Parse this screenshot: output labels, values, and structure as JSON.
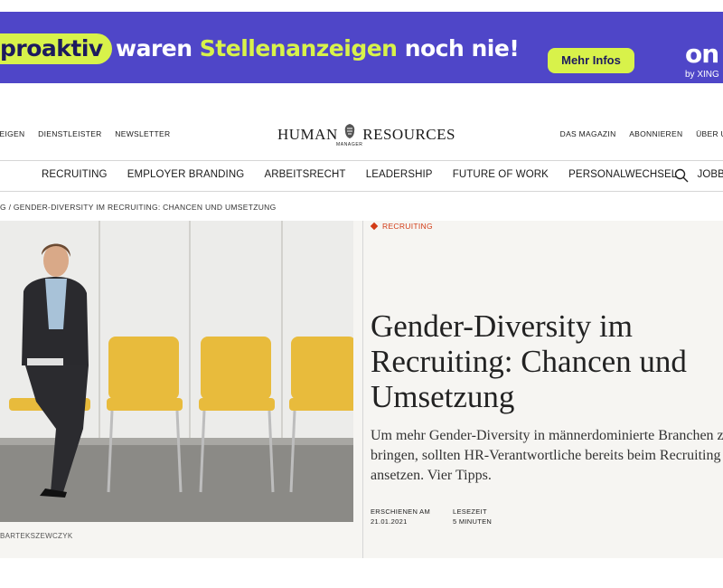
{
  "ad": {
    "pill_text": "proaktiv",
    "text_main": "waren",
    "text_highlight": "Stellenanzeigen",
    "text_end": "noch nie!",
    "button_label": "Mehr Infos",
    "logo": "on",
    "logo_sub": "by XING",
    "colors": {
      "background": "#4f46c8",
      "accent": "#d8f24a"
    }
  },
  "util_nav_left": [
    "ZEIGEN",
    "DIENSTLEISTER",
    "NEWSLETTER"
  ],
  "util_nav_right": [
    "DAS MAGAZIN",
    "ABONNIEREN",
    "ÜBER U"
  ],
  "brand": {
    "left": "HUMAN",
    "right": "RESOURCES",
    "sub": "MANAGER"
  },
  "main_nav": [
    "RECRUITING",
    "EMPLOYER BRANDING",
    "ARBEITSRECHT",
    "LEADERSHIP",
    "FUTURE OF WORK",
    "PERSONALWECHSEL",
    "JOBBÖRSE"
  ],
  "breadcrumb": "G / GENDER-DIVERSITY IM RECRUITING: CHANCEN UND UMSETZUNG",
  "article": {
    "category": "RECRUITING",
    "title": "Gender-Diversity im Recruiting: Chancen und Umsetzung",
    "lead": "Um mehr Gender-Diversity in männerdominierte Branchen zu bringen, sollten HR-Verantwortliche bereits beim Recruiting ansetzen. Vier Tipps.",
    "published_label": "ERSCHIENEN AM",
    "published_date": "21.01.2021",
    "readtime_label": "LESEZEIT",
    "readtime_value": "5 MINUTEN",
    "photo_credit": "BARTEKSZEWCZYK",
    "accent_color": "#d23b16"
  }
}
